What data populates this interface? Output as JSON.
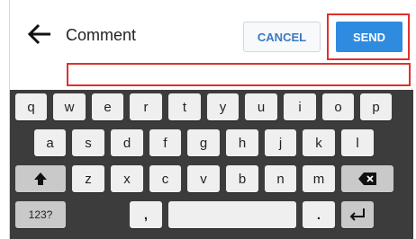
{
  "header": {
    "title": "Comment",
    "cancel_label": "CANCEL",
    "send_label": "SEND"
  },
  "comment_input": {
    "value": "",
    "placeholder": ""
  },
  "keyboard": {
    "row1": [
      "q",
      "w",
      "e",
      "r",
      "t",
      "y",
      "u",
      "i",
      "o",
      "p"
    ],
    "row2": [
      "a",
      "s",
      "d",
      "f",
      "g",
      "h",
      "j",
      "k",
      "l"
    ],
    "row3": [
      "z",
      "x",
      "c",
      "v",
      "b",
      "n",
      "m"
    ],
    "numbers_key": "123?",
    "comma_key": ",",
    "period_key": ".",
    "icons": {
      "back": "arrow-left",
      "shift": "shift-up-arrow",
      "backspace": "backspace",
      "enter": "enter-return"
    }
  },
  "colors": {
    "accent": "#2f8be0",
    "highlight": "#e0312d",
    "keyboard_bg": "#3c3c3c",
    "key_bg": "#efefef"
  }
}
